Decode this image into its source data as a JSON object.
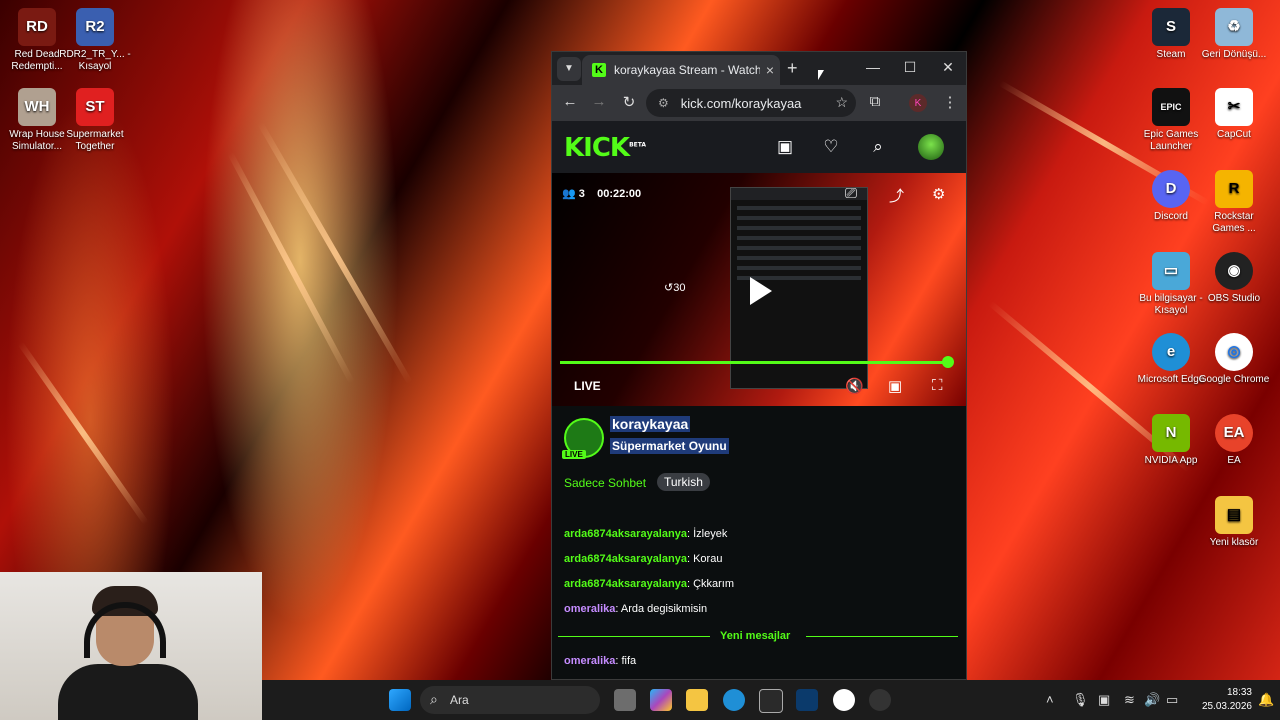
{
  "desktop": {
    "left_icons": [
      {
        "label": "Red Dead Redempti...",
        "color": "#7a1a12",
        "glyph": "RD"
      },
      {
        "label": "RDR2_TR_Y... - Kısayol",
        "color": "#3a5fb0",
        "glyph": "R2"
      },
      {
        "label": "Wrap House Simulator...",
        "color": "#b0a090",
        "glyph": "WH"
      },
      {
        "label": "Supermarket Together",
        "color": "#e02020",
        "glyph": "ST"
      }
    ],
    "right_icons": [
      {
        "label": "Steam",
        "color": "#1b2838",
        "glyph": "S"
      },
      {
        "label": "Geri Dönüşü...",
        "color": "#8fb8d8",
        "glyph": "♻"
      },
      {
        "label": "Epic Games Launcher",
        "color": "#111111",
        "glyph": "EPIC"
      },
      {
        "label": "CapCut",
        "color": "#ffffff",
        "glyph": "✂"
      },
      {
        "label": "Discord",
        "color": "#5865f2",
        "glyph": "D"
      },
      {
        "label": "Rockstar Games ...",
        "color": "#f5b400",
        "glyph": "R"
      },
      {
        "label": "Bu bilgisayar - Kısayol",
        "color": "#4aa8d8",
        "glyph": "▭"
      },
      {
        "label": "OBS Studio",
        "color": "#222222",
        "glyph": "◉"
      },
      {
        "label": "Microsoft Edge",
        "color": "#1f8fd6",
        "glyph": "e"
      },
      {
        "label": "Google Chrome",
        "color": "#ffffff",
        "glyph": "◎"
      },
      {
        "label": "NVIDIA App",
        "color": "#76b900",
        "glyph": "N"
      },
      {
        "label": "EA",
        "color": "#e8432a",
        "glyph": "EA"
      },
      {
        "label": "Yeni klasör",
        "color": "#f4c542",
        "glyph": "▤"
      }
    ]
  },
  "browser": {
    "tab_title": "koraykayaa Stream - Watch Live",
    "url": "kick.com/koraykayaa",
    "profile_initial": "K"
  },
  "kick": {
    "logo": "KICK",
    "logo_badge": "BETA"
  },
  "player": {
    "viewers": "3",
    "elapsed": "00:22:00",
    "live_label": "LIVE",
    "replay_label": "30",
    "progress": 0.99
  },
  "channel": {
    "name": "koraykayaa",
    "category": "Süpermarket Oyunu",
    "live_badge": "LIVE",
    "chat_mode": "Sadece Sohbet",
    "language": "Turkish"
  },
  "chat": {
    "messages": [
      {
        "user": "arda6874aksarayalanya",
        "text": "İzleyek",
        "color": "#53fc18"
      },
      {
        "user": "arda6874aksarayalanya",
        "text": "Korau",
        "color": "#53fc18"
      },
      {
        "user": "arda6874aksarayalanya",
        "text": "Çkkarım",
        "color": "#53fc18"
      },
      {
        "user": "omeralika",
        "text": "Arda degisikmisin",
        "color": "#c58cff"
      }
    ],
    "new_messages_label": "Yeni mesajlar",
    "new_message": {
      "user": "omeralika",
      "text": "fifa",
      "color": "#c58cff"
    }
  },
  "taskbar": {
    "search_placeholder": "Ara",
    "time": "18:33",
    "date": "25.03.2026"
  },
  "colors": {
    "kick_green": "#53fc18",
    "chat_bg": "#0b0e0f"
  }
}
